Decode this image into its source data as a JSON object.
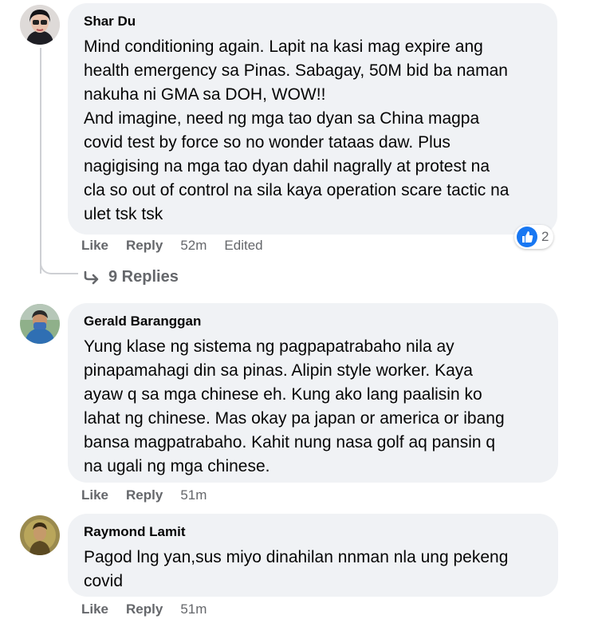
{
  "comments": [
    {
      "author": "Shar Du",
      "lines": [
        "Mind conditioning again. Lapit na kasi mag expire ang",
        "health emergency sa Pinas. Sabagay, 50M bid ba naman",
        "nakuha ni GMA sa DOH, WOW!!",
        "And imagine, need ng mga tao dyan sa China magpa",
        "covid test by force so no wonder tataas daw. Plus",
        "nagigising na mga tao dyan dahil nagrally at protest na",
        "cla so out of control na sila kaya operation scare tactic na",
        "ulet tsk tsk"
      ],
      "like": "Like",
      "reply": "Reply",
      "time": "52m",
      "edited": "Edited",
      "reaction_count": "2",
      "reaction_icon": "thumbs-up-icon",
      "replies_label": "9 Replies"
    },
    {
      "author": "Gerald Baranggan",
      "lines": [
        "Yung klase ng sistema ng pagpapatrabaho nila ay",
        "pinapamahagi din sa pinas. Alipin style worker. Kaya",
        "ayaw q sa mga chinese eh. Kung ako lang paalisin ko",
        "lahat ng chinese. Mas okay pa japan or america or ibang",
        "bansa magpatrabaho. Kahit nung nasa golf aq pansin q",
        "na ugali ng mga chinese."
      ],
      "like": "Like",
      "reply": "Reply",
      "time": "51m"
    },
    {
      "author": "Raymond Lamit",
      "lines": [
        "Pagod lng yan,sus miyo dinahilan nnman nla ung pekeng",
        "covid"
      ],
      "like": "Like",
      "reply": "Reply",
      "time": "51m"
    }
  ],
  "colors": {
    "bubble": "#f0f2f5",
    "meta": "#65676b",
    "like_blue": "#1877f2"
  }
}
